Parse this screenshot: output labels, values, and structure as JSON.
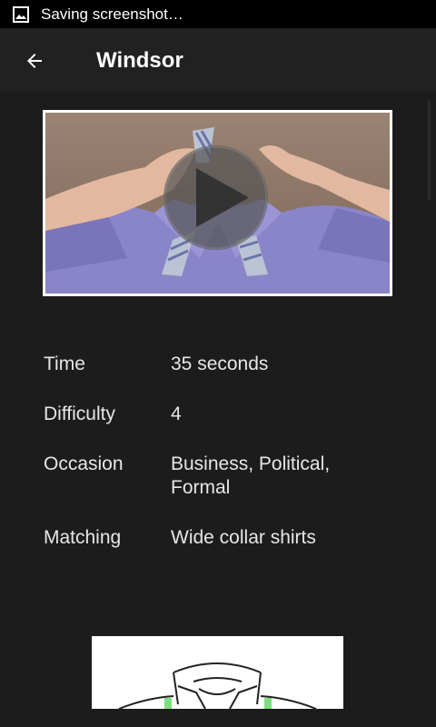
{
  "status_bar": {
    "text": "Saving screenshot…",
    "icon": "image-icon"
  },
  "app_bar": {
    "title": "Windsor",
    "back_icon": "arrow-left-icon"
  },
  "video": {
    "play_icon": "play-icon"
  },
  "details": [
    {
      "label": "Time",
      "value": "35 seconds"
    },
    {
      "label": "Difficulty",
      "value": "4"
    },
    {
      "label": "Occasion",
      "value": "Business, Political, Formal"
    },
    {
      "label": "Matching",
      "value": "Wide collar shirts"
    }
  ]
}
